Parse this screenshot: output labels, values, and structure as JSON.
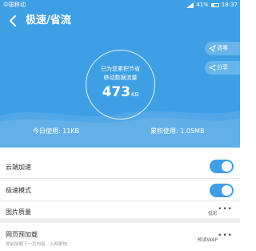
{
  "status_bar": {
    "carrier": "中国移动",
    "battery_percent": "41%",
    "time": "18:37"
  },
  "header": {
    "title": "极速/省流"
  },
  "summary": {
    "saved_line1": "已为您累积节省",
    "saved_line2": "移动数据流量",
    "saved_amount": "473",
    "saved_unit": "KB",
    "clean_label": "清零",
    "share_label": "分享",
    "today_usage": "今日使用: 11KB",
    "total_usage": "累积使用: 1.05MB"
  },
  "settings": {
    "cloud_accel": {
      "label": "云端加速",
      "enabled": true
    },
    "speed_mode": {
      "label": "极速模式",
      "enabled": true
    },
    "image_quality": {
      "label": "图片质量",
      "value": "低彩"
    },
    "preload": {
      "label": "网页预加载",
      "desc": "提前加载下一页内容，上网更快",
      "value": "预读WAP"
    }
  },
  "colors": {
    "accent": "#3f9fe5"
  }
}
